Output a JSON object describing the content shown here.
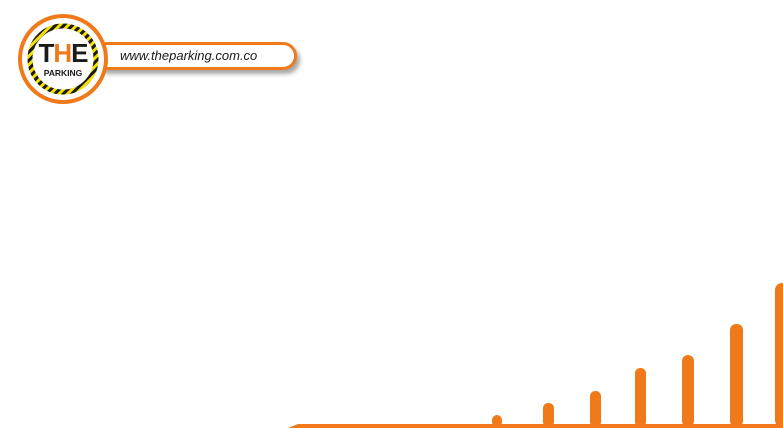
{
  "header": {
    "logo_line1": "THE",
    "logo_line2": "PARKING",
    "url": "www.theparking.com.co"
  },
  "colors": {
    "brand_orange": "#f07a1a",
    "logo_ring_yellow": "#f5e100",
    "logo_dark": "#1a1a1a"
  },
  "icons": {
    "logo": "the-parking-logo",
    "bottom_graphic": "orange-rising-bars"
  }
}
